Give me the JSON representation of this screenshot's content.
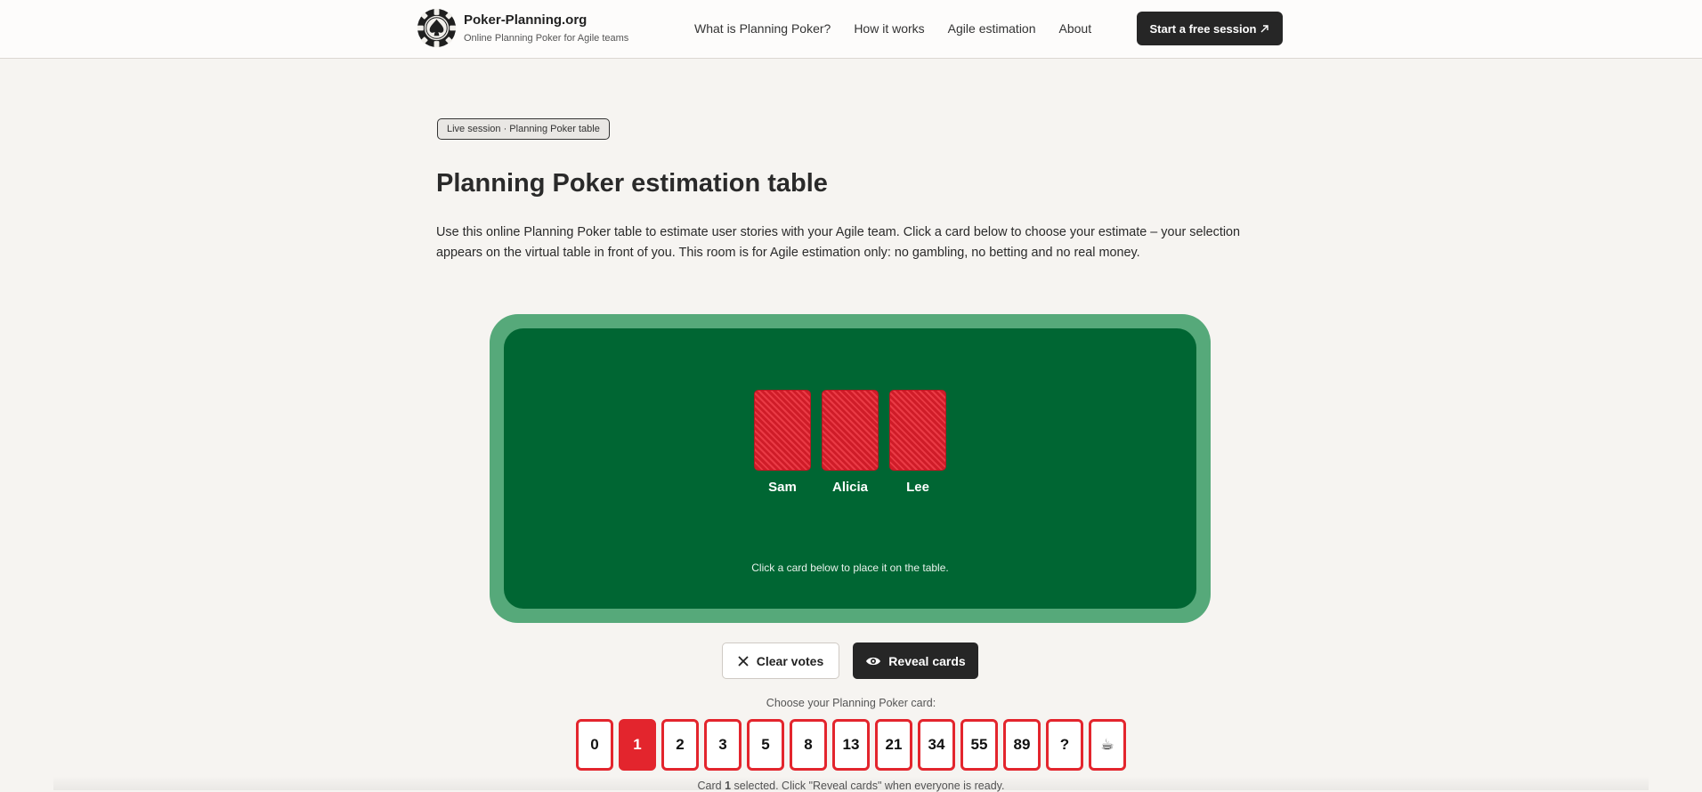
{
  "header": {
    "brand_name": "Poker-Planning.org",
    "brand_tagline": "Online Planning Poker for Agile teams",
    "logo_icon": "poker-chip-spade-icon",
    "nav": [
      {
        "label": "What is Planning Poker?"
      },
      {
        "label": "How it works"
      },
      {
        "label": "Agile estimation"
      },
      {
        "label": "About"
      }
    ],
    "cta_label": "Start a free session",
    "cta_icon": "external-arrow-icon"
  },
  "main": {
    "pill": "Live session · Planning Poker table",
    "title": "Planning Poker estimation table",
    "intro": "Use this online Planning Poker table to estimate user stories with your Agile team. Click a card below to choose your estimate – your selection appears on the virtual table in front of you. This room is for Agile estimation only: no gambling, no betting and no real money."
  },
  "table": {
    "players": [
      {
        "name": "Sam"
      },
      {
        "name": "Alicia"
      },
      {
        "name": "Lee"
      }
    ],
    "hint": "Click a card below to place it on the table.",
    "colors": {
      "rim": "#56a97a",
      "felt": "#006633",
      "card_back": "#d41f2c"
    }
  },
  "actions": {
    "clear_label": "Clear votes",
    "clear_icon": "close-icon",
    "reveal_label": "Reveal cards",
    "reveal_icon": "eye-icon"
  },
  "deck": {
    "prompt": "Choose your Planning Poker card:",
    "cards": [
      "0",
      "1",
      "2",
      "3",
      "5",
      "8",
      "13",
      "21",
      "34",
      "55",
      "89",
      "?",
      "☕"
    ],
    "selected": "1",
    "accent": "#e3252d",
    "status_prefix": "Card ",
    "status_value": "1",
    "status_suffix": " selected. Click \"Reveal cards\" when everyone is ready."
  }
}
